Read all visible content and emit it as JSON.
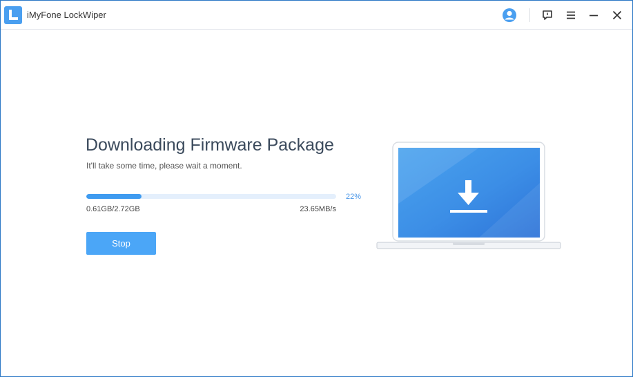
{
  "window": {
    "title": "iMyFone LockWiper"
  },
  "titlebar_icons": {
    "account": "user-avatar-icon",
    "feedback": "chat-bubble-icon",
    "menu": "hamburger-menu-icon",
    "minimize": "minimize-icon",
    "close": "close-icon"
  },
  "main": {
    "heading": "Downloading Firmware Package",
    "subtitle": "It'll take some time, please wait a moment.",
    "progress": {
      "percent_label": "22%",
      "value": 0.22,
      "size_label": "0.61GB/2.72GB",
      "speed_label": "23.65MB/s"
    },
    "stop_button": "Stop"
  },
  "colors": {
    "accent": "#4ba6f7",
    "progress_fill": "#3f9bf0",
    "progress_track": "#e4effc",
    "heading": "#3b4a5c"
  }
}
